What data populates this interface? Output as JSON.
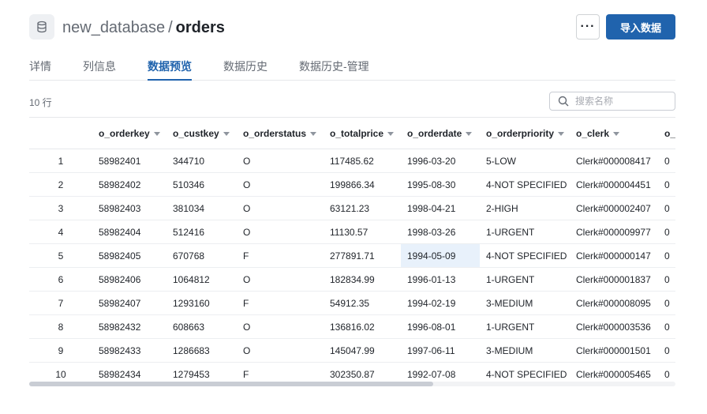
{
  "header": {
    "database": "new_database",
    "separator": "/",
    "table": "orders",
    "more_label": "···",
    "import_label": "导入数据"
  },
  "tabs": [
    {
      "label": "详情",
      "active": false
    },
    {
      "label": "列信息",
      "active": false
    },
    {
      "label": "数据预览",
      "active": true
    },
    {
      "label": "数据历史",
      "active": false
    },
    {
      "label": "数据历史-管理",
      "active": false
    }
  ],
  "row_count": "10 行",
  "search": {
    "placeholder": "搜索名称",
    "icon": "search-icon"
  },
  "columns": [
    "o_orderkey",
    "o_custkey",
    "o_orderstatus",
    "o_totalprice",
    "o_orderdate",
    "o_orderpriority",
    "o_clerk",
    "o_"
  ],
  "rows": [
    [
      "1",
      "58982401",
      "344710",
      "O",
      "117485.62",
      "1996-03-20",
      "5-LOW",
      "Clerk#000008417",
      "0"
    ],
    [
      "2",
      "58982402",
      "510346",
      "O",
      "199866.34",
      "1995-08-30",
      "4-NOT SPECIFIED",
      "Clerk#000004451",
      "0"
    ],
    [
      "3",
      "58982403",
      "381034",
      "O",
      "63121.23",
      "1998-04-21",
      "2-HIGH",
      "Clerk#000002407",
      "0"
    ],
    [
      "4",
      "58982404",
      "512416",
      "O",
      "11130.57",
      "1998-03-26",
      "1-URGENT",
      "Clerk#000009977",
      "0"
    ],
    [
      "5",
      "58982405",
      "670768",
      "F",
      "277891.71",
      "1994-05-09",
      "4-NOT SPECIFIED",
      "Clerk#000000147",
      "0"
    ],
    [
      "6",
      "58982406",
      "1064812",
      "O",
      "182834.99",
      "1996-01-13",
      "1-URGENT",
      "Clerk#000001837",
      "0"
    ],
    [
      "7",
      "58982407",
      "1293160",
      "F",
      "54912.35",
      "1994-02-19",
      "3-MEDIUM",
      "Clerk#000008095",
      "0"
    ],
    [
      "8",
      "58982432",
      "608663",
      "O",
      "136816.02",
      "1996-08-01",
      "1-URGENT",
      "Clerk#000003536",
      "0"
    ],
    [
      "9",
      "58982433",
      "1286683",
      "O",
      "145047.99",
      "1997-06-11",
      "3-MEDIUM",
      "Clerk#000001501",
      "0"
    ],
    [
      "10",
      "58982434",
      "1279453",
      "F",
      "302350.87",
      "1992-07-08",
      "4-NOT SPECIFIED",
      "Clerk#000005465",
      "0"
    ]
  ],
  "selected_cell": {
    "row": 4,
    "column": "o_orderdate"
  },
  "colors": {
    "accent": "#2063ad",
    "selected_cell": "#e8f1fb"
  }
}
